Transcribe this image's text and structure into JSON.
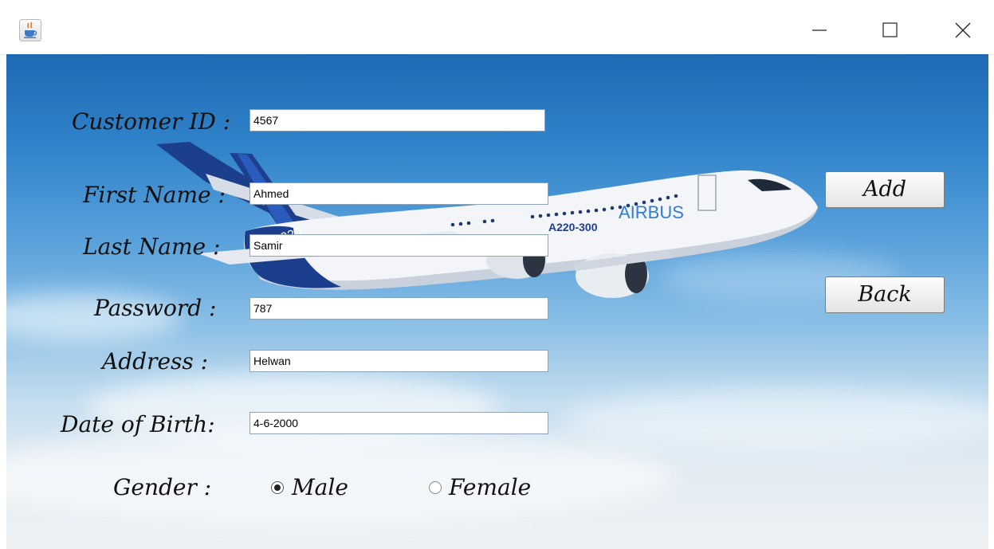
{
  "titlebar": {
    "app_icon": "java-cup-icon",
    "controls": [
      "minimize-icon",
      "maximize-icon",
      "close-icon"
    ]
  },
  "background": {
    "plane_text_model": "A220-300",
    "plane_text_brand": "AIRBUS",
    "plane_tail_text": "A220"
  },
  "form": {
    "customer_id_label": "Customer ID :",
    "customer_id_value": "4567",
    "first_name_label": "First Name :",
    "first_name_value": "Ahmed",
    "last_name_label": "Last Name :",
    "last_name_value": "Samir",
    "password_label": "Password  :",
    "password_value": "787",
    "address_label": "Address :",
    "address_value": "Helwan",
    "dob_label": "Date of Birth:",
    "dob_value": "4-6-2000",
    "gender_label": "Gender :",
    "gender_male_label": "Male",
    "gender_female_label": "Female",
    "gender_selected": "Male"
  },
  "buttons": {
    "add_label": "Add",
    "back_label": "Back"
  }
}
